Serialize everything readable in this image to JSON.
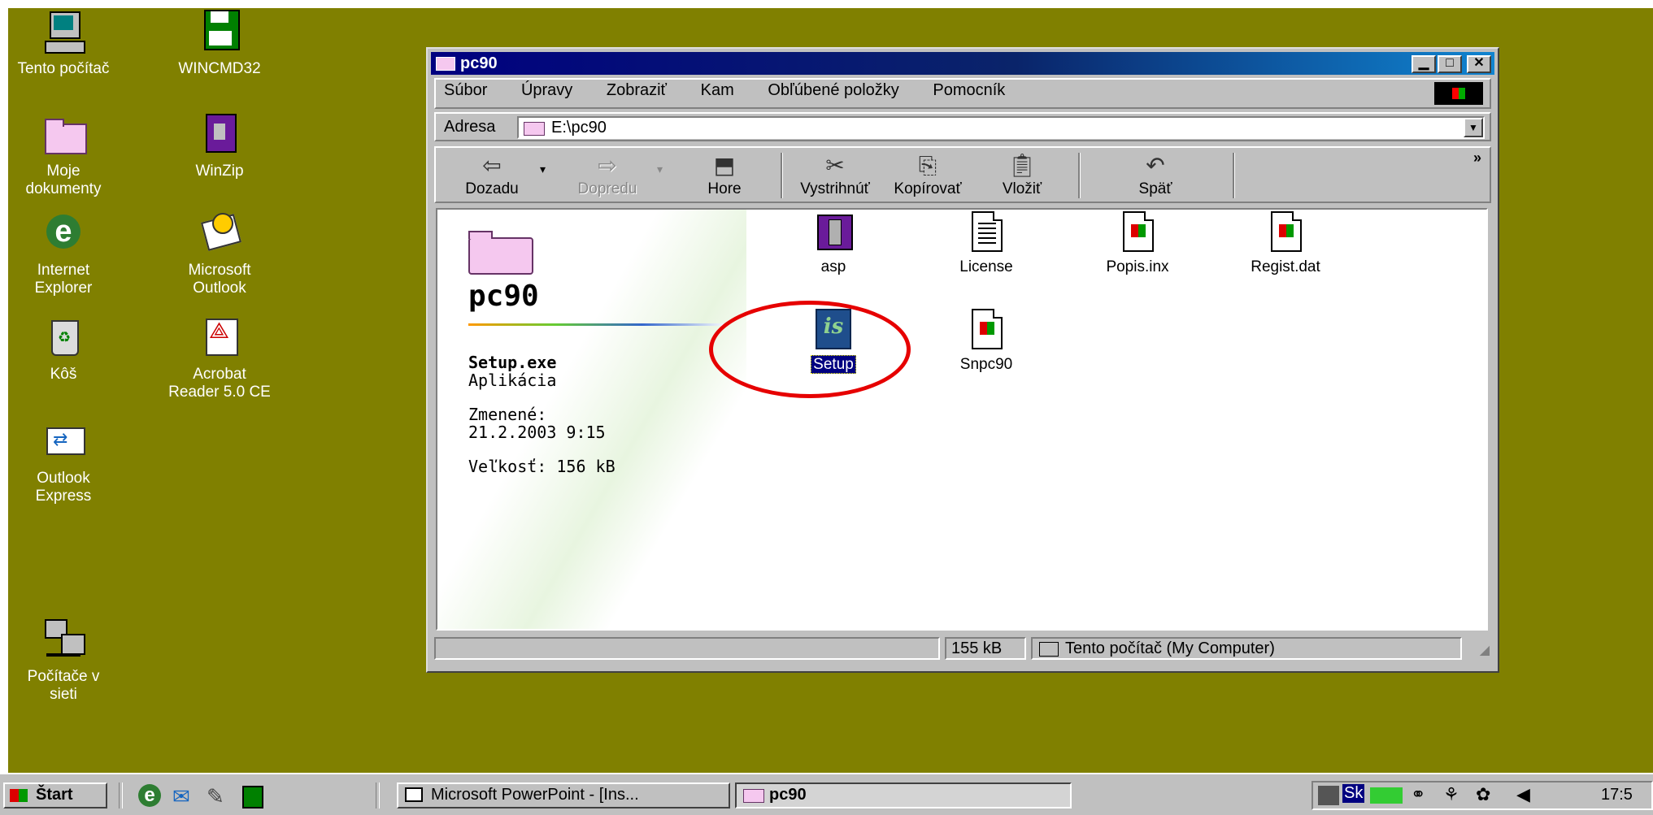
{
  "desktop": {
    "icons": [
      {
        "label": "Tento počítač",
        "icon": "my-computer-icon"
      },
      {
        "label": "WINCMD32",
        "icon": "floppy-disk-icon"
      },
      {
        "label": "Moje\ndokumenty",
        "icon": "folder-icon"
      },
      {
        "label": "WinZip",
        "icon": "winzip-icon"
      },
      {
        "label": "Internet\nExplorer",
        "icon": "internet-explorer-icon"
      },
      {
        "label": "Microsoft\nOutlook",
        "icon": "outlook-icon"
      },
      {
        "label": "Kôš",
        "icon": "recycle-bin-icon"
      },
      {
        "label": "Acrobat\nReader 5.0 CE",
        "icon": "acrobat-icon"
      },
      {
        "label": "Outlook\nExpress",
        "icon": "outlook-express-icon"
      },
      {
        "label": "Počítače v\nsieti",
        "icon": "network-icon"
      }
    ],
    "color": "#808000"
  },
  "window": {
    "title": "pc90",
    "menu": [
      "Súbor",
      "Úpravy",
      "Zobraziť",
      "Kam",
      "Obľúbené položky",
      "Pomocník"
    ],
    "address_label": "Adresa",
    "address_value": "E:\\pc90",
    "toolbar": {
      "back": "Dozadu",
      "forward": "Dopredu",
      "up": "Hore",
      "cut": "Vystrihnúť",
      "copy": "Kopírovať",
      "paste": "Vložiť",
      "undo": "Späť",
      "more": "»"
    },
    "side": {
      "folder_name": "pc90",
      "selected_file": "Setup.exe",
      "file_type": "Aplikácia",
      "modified_label": "Zmenené:",
      "modified_value": "21.2.2003 9:15",
      "size": "Veľkosť: 156 kB"
    },
    "files": [
      {
        "name": "asp",
        "icon": "compressed-archive-icon"
      },
      {
        "name": "License",
        "icon": "text-document-icon"
      },
      {
        "name": "Popis.inx",
        "icon": "windows-file-icon"
      },
      {
        "name": "Regist.dat",
        "icon": "windows-file-icon"
      },
      {
        "name": "Setup",
        "icon": "installshield-setup-icon",
        "selected": true
      },
      {
        "name": "Snpc90",
        "icon": "windows-file-icon"
      }
    ],
    "status": {
      "size": "155 kB",
      "location": "Tento počítač (My Computer)"
    }
  },
  "taskbar": {
    "start": "Štart",
    "items": [
      "Microsoft PowerPoint - [Ins...",
      "pc90"
    ],
    "tray_lang": "Sk",
    "clock": "17:5"
  },
  "highlight_color": "#e60000"
}
